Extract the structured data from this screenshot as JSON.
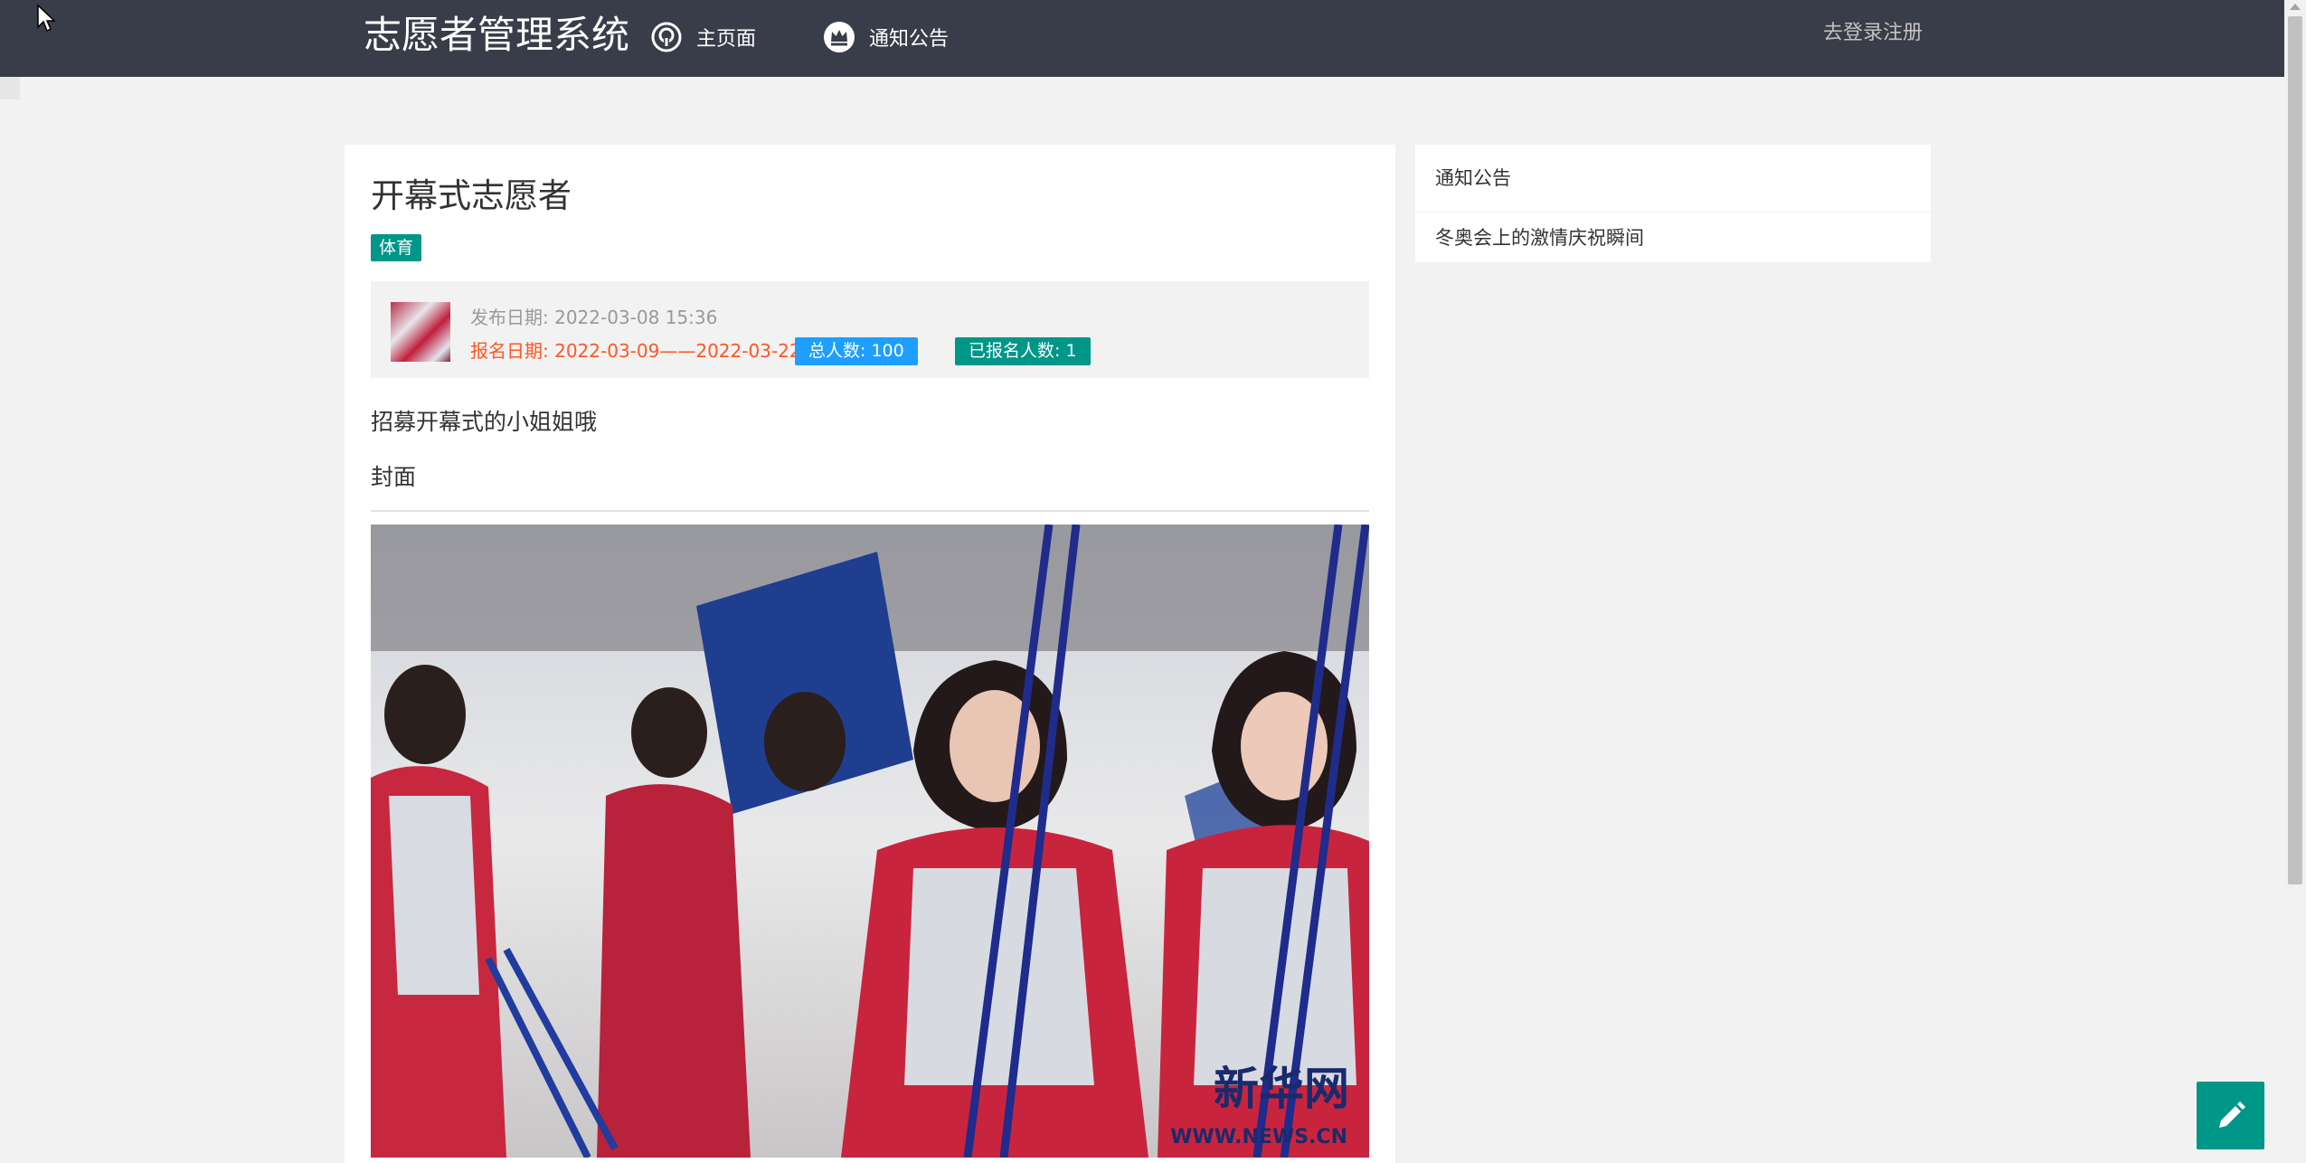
{
  "header": {
    "logo": "志愿者管理系统",
    "nav": [
      {
        "label": "主页面",
        "icon": "home-icon"
      },
      {
        "label": "通知公告",
        "icon": "crown-icon"
      }
    ],
    "login_label": "去登录注册"
  },
  "article": {
    "title": "开幕式志愿者",
    "tag": "体育",
    "meta": {
      "publish_label": "发布日期:",
      "publish_date": "2022-03-08 15:36",
      "register_label": "报名日期:",
      "register_range": "2022-03-09——2022-03-22",
      "total_label": "总人数:",
      "total": "100",
      "signed_label": "已报名人数:",
      "signed": "1"
    },
    "description": "招募开幕式的小姐姐哦",
    "cover_label": "封面",
    "cover_watermark_cn": "新华网",
    "cover_watermark_en": "WWW.NEWS.CN"
  },
  "sidebar": {
    "heading": "通知公告",
    "items": [
      "冬奥会上的激情庆祝瞬间"
    ]
  },
  "colors": {
    "header_bg": "#393d49",
    "accent_green": "#009688",
    "accent_blue": "#1e9fff",
    "accent_orange": "#ff5722",
    "page_bg": "#f2f2f2"
  },
  "fab": {
    "icon": "pencil-icon"
  }
}
